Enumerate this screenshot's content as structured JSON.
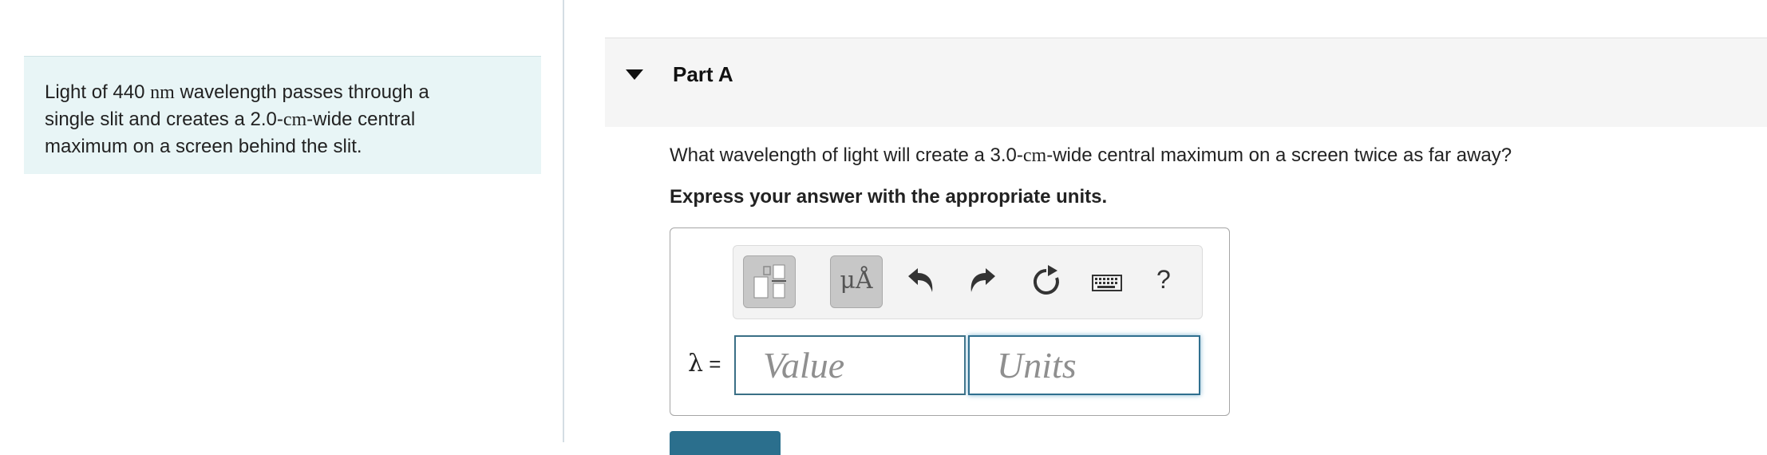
{
  "intro": {
    "line1_pre": "Light of 440 ",
    "line1_unit": "nm",
    "line1_post": " wavelength passes through a",
    "line2_pre": "single slit and creates a 2.0-",
    "line2_unit": "cm",
    "line2_post": "-wide central",
    "line3": "maximum on a screen behind the slit."
  },
  "part": {
    "title": "Part A"
  },
  "question": {
    "pre": "What wavelength of light will create a 3.0-",
    "unit": "cm",
    "post": "-wide central maximum on a screen twice as far away?"
  },
  "instruction": "Express your answer with the appropriate units.",
  "toolbar": {
    "units_button_label": "μÅ",
    "help_label": "?",
    "icons": [
      "templates-icon",
      "units-icon",
      "undo-icon",
      "redo-icon",
      "reset-icon",
      "keyboard-icon",
      "help-icon"
    ]
  },
  "answer": {
    "variable": "λ",
    "equals": "=",
    "value_placeholder": "Value",
    "units_placeholder": "Units"
  },
  "colors": {
    "intro_bg": "#e8f5f6",
    "accent": "#2b6f8d",
    "field_border": "#3a6f86"
  }
}
